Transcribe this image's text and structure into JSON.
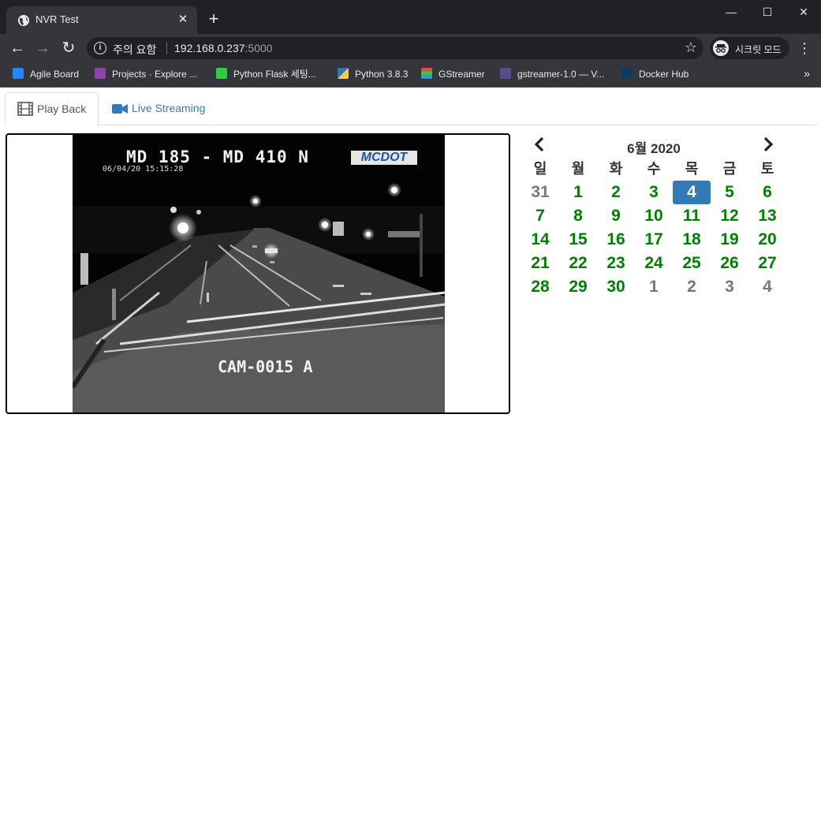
{
  "browser": {
    "tab_title": "NVR Test",
    "tab_close": "✕",
    "new_tab": "+",
    "window_controls": {
      "minimize": "—",
      "maximize": "☐",
      "close": "✕"
    },
    "nav": {
      "back": "←",
      "forward": "→",
      "reload": "↻"
    },
    "address": {
      "security_warning": "주의 요함",
      "host": "192.168.0.237",
      "port": ":5000"
    },
    "incognito_label": "시크릿 모드",
    "bookmarks": [
      {
        "label": "Agile Board",
        "icon_color": "#2684ff"
      },
      {
        "label": "Projects · Explore ...",
        "icon_color": "#8e44ad"
      },
      {
        "label": "Python Flask 세팅...",
        "icon_color": "#2ecc40"
      },
      {
        "label": "Python 3.8.3",
        "icon_color": "#f7c948"
      },
      {
        "label": "GStreamer",
        "icon_color": "#e74c3c"
      },
      {
        "label": "gstreamer-1.0 — V...",
        "icon_color": "#5b4b8a"
      },
      {
        "label": "Docker Hub",
        "icon_color": "#0b3b63"
      }
    ],
    "bookmarks_more": "»"
  },
  "tabs": [
    {
      "label": "Play Back",
      "icon": "film-icon",
      "active": true
    },
    {
      "label": "Live Streaming",
      "icon": "video-camera-icon",
      "active": false
    }
  ],
  "video": {
    "road_label": "MD  185 - MD 410 N",
    "timestamp": "06/04/20 15:15:28",
    "camera_label": "CAM-0015 A",
    "logo": "MCDOT"
  },
  "calendar": {
    "title": "6월 2020",
    "weekdays": [
      "일",
      "월",
      "화",
      "수",
      "목",
      "금",
      "토"
    ],
    "weeks": [
      [
        {
          "d": "31",
          "other": true
        },
        {
          "d": "1"
        },
        {
          "d": "2"
        },
        {
          "d": "3"
        },
        {
          "d": "4",
          "selected": true
        },
        {
          "d": "5"
        },
        {
          "d": "6"
        }
      ],
      [
        {
          "d": "7"
        },
        {
          "d": "8"
        },
        {
          "d": "9"
        },
        {
          "d": "10"
        },
        {
          "d": "11"
        },
        {
          "d": "12"
        },
        {
          "d": "13"
        }
      ],
      [
        {
          "d": "14"
        },
        {
          "d": "15"
        },
        {
          "d": "16"
        },
        {
          "d": "17"
        },
        {
          "d": "18"
        },
        {
          "d": "19"
        },
        {
          "d": "20"
        }
      ],
      [
        {
          "d": "21"
        },
        {
          "d": "22"
        },
        {
          "d": "23"
        },
        {
          "d": "24"
        },
        {
          "d": "25"
        },
        {
          "d": "26"
        },
        {
          "d": "27"
        }
      ],
      [
        {
          "d": "28"
        },
        {
          "d": "29"
        },
        {
          "d": "30"
        },
        {
          "d": "1",
          "other": true
        },
        {
          "d": "2",
          "other": true
        },
        {
          "d": "3",
          "other": true
        },
        {
          "d": "4",
          "other": true
        }
      ]
    ],
    "colors": {
      "available": "#008000",
      "other_month": "#777777",
      "selected_bg": "#337ab7"
    }
  }
}
